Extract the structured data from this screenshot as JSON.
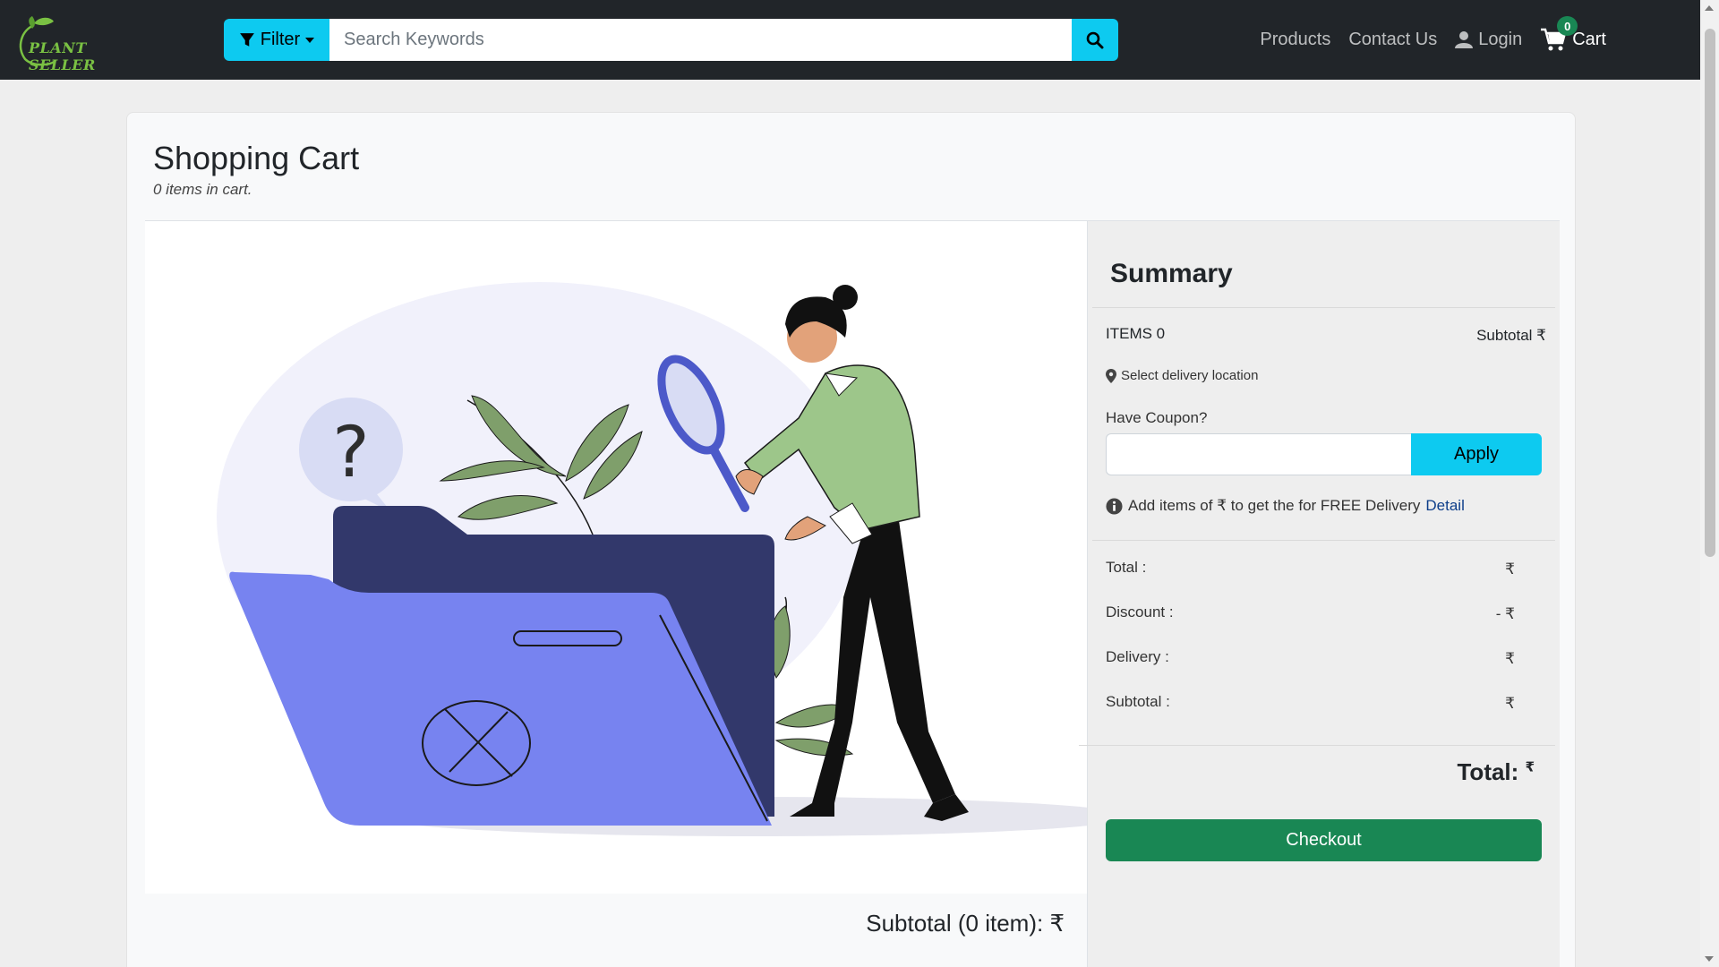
{
  "header": {
    "logo_text": "PLANT SELLER",
    "filter_label": "Filter",
    "search_placeholder": "Search Keywords",
    "nav": {
      "products": "Products",
      "contact": "Contact Us",
      "login": "Login",
      "cart": "Cart",
      "cart_count": "0"
    }
  },
  "cart": {
    "title": "Shopping Cart",
    "subtitle": "0 items in cart.",
    "bottom_subtotal": "Subtotal (0 item): ₹"
  },
  "summary": {
    "title": "Summary",
    "items_label": "ITEMS 0",
    "subtotal_label": "Subtotal ₹",
    "delivery_location": "Select delivery location",
    "coupon_label": "Have Coupon?",
    "coupon_value": "",
    "apply_label": "Apply",
    "free_delivery_text": "Add items of ₹ to get the for FREE Delivery",
    "detail_link": "Detail",
    "lines": [
      {
        "label": "Total :",
        "value": "₹"
      },
      {
        "label": "Discount :",
        "value": "- ₹"
      },
      {
        "label": "Delivery :",
        "value": "₹"
      },
      {
        "label": "Subtotal :",
        "value": "₹"
      }
    ],
    "grand_total_label": "Total:",
    "grand_total_currency": "₹",
    "checkout_label": "Checkout"
  },
  "colors": {
    "navbar": "#212529",
    "accent_cyan": "#0dcaf0",
    "checkout_green": "#198754",
    "folder_front": "#7783f0",
    "folder_back": "#32386b",
    "shirt_green": "#9dc68a"
  }
}
